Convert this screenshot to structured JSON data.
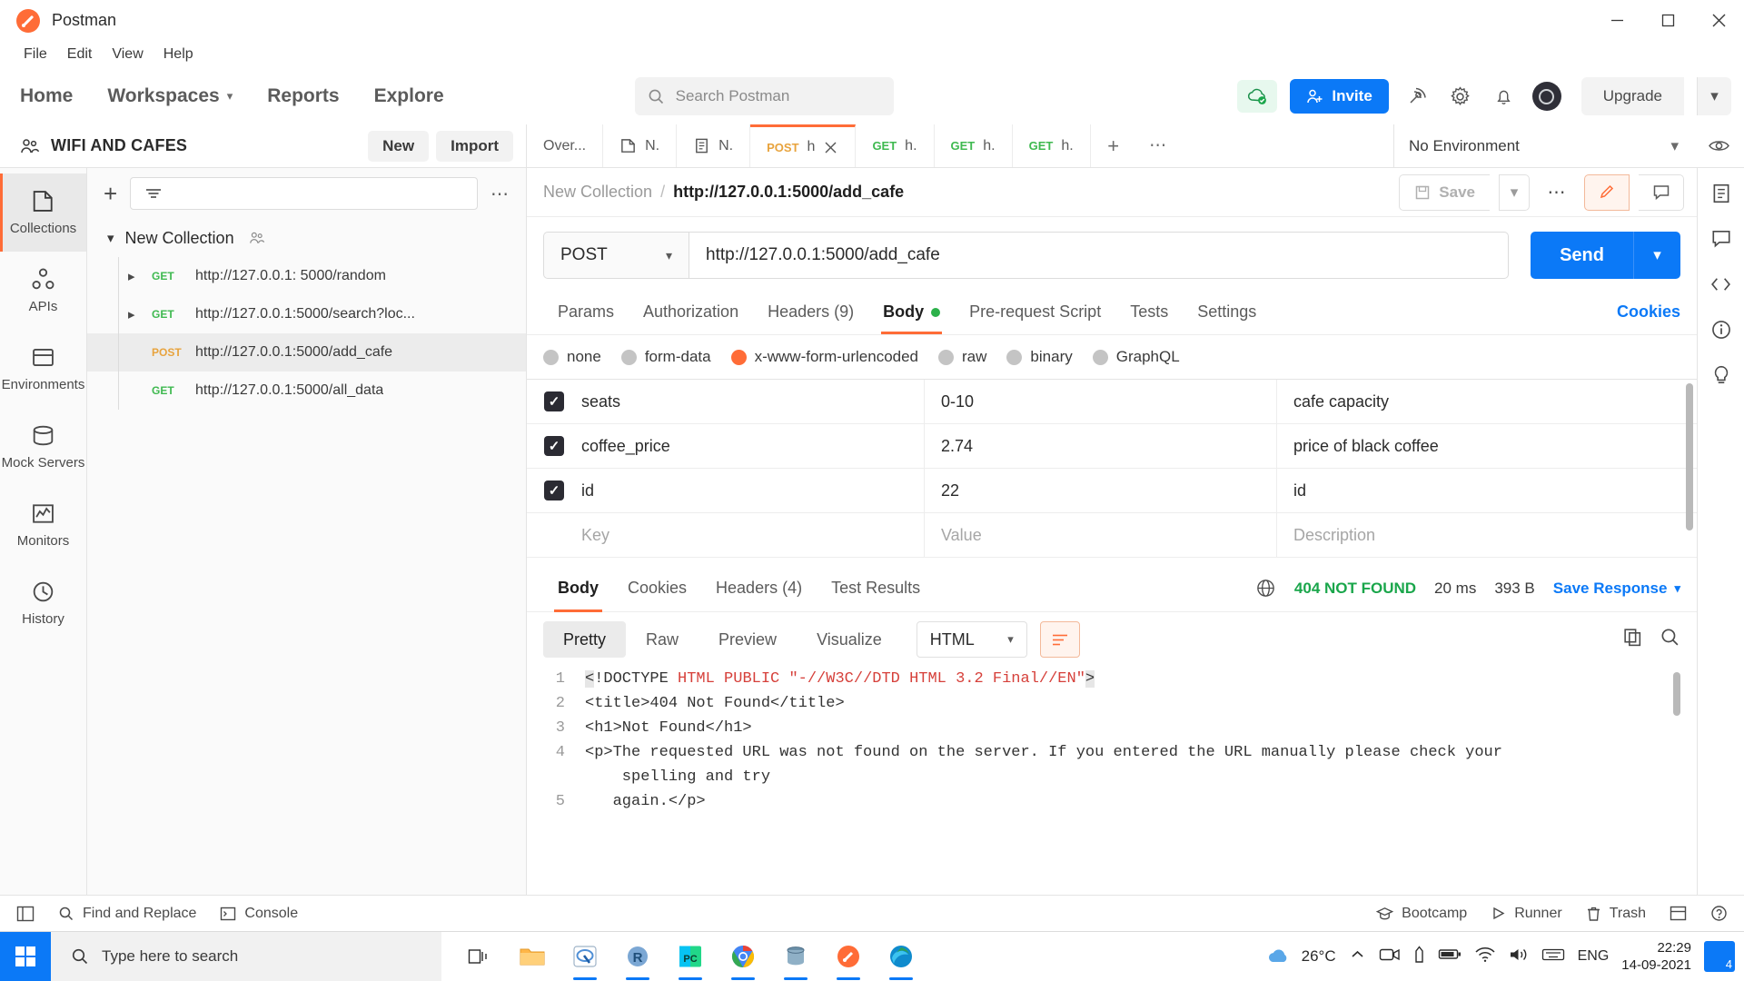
{
  "window": {
    "title": "Postman",
    "minimize": "minimize-icon",
    "maximize": "maximize-icon",
    "close": "close-icon"
  },
  "menubar": [
    "File",
    "Edit",
    "View",
    "Help"
  ],
  "header": {
    "nav": [
      "Home",
      "Workspaces",
      "Reports",
      "Explore"
    ],
    "search_placeholder": "Search Postman",
    "invite_label": "Invite",
    "upgrade_label": "Upgrade"
  },
  "workspace": {
    "name": "WIFI AND CAFES",
    "new_label": "New",
    "import_label": "Import",
    "environment": "No Environment"
  },
  "tabs": [
    {
      "label": "Over...",
      "method": "",
      "icon": "",
      "active": false
    },
    {
      "label": "N.",
      "method": "",
      "icon": "collection-icon",
      "active": false
    },
    {
      "label": "N.",
      "method": "",
      "icon": "document-icon",
      "active": false
    },
    {
      "label": "h",
      "method": "POST",
      "icon": "",
      "active": true
    },
    {
      "label": "h.",
      "method": "GET",
      "icon": "",
      "active": false
    },
    {
      "label": "h.",
      "method": "GET",
      "icon": "",
      "active": false
    },
    {
      "label": "h.",
      "method": "GET",
      "icon": "",
      "active": false
    }
  ],
  "rail": [
    {
      "label": "Collections",
      "icon": "collections-icon",
      "active": true
    },
    {
      "label": "APIs",
      "icon": "apis-icon",
      "active": false
    },
    {
      "label": "Environments",
      "icon": "environments-icon",
      "active": false
    },
    {
      "label": "Mock Servers",
      "icon": "mock-servers-icon",
      "active": false
    },
    {
      "label": "Monitors",
      "icon": "monitors-icon",
      "active": false
    },
    {
      "label": "History",
      "icon": "history-icon",
      "active": false
    }
  ],
  "sidebar": {
    "filter_placeholder": "",
    "collection_name": "New Collection",
    "requests": [
      {
        "method": "GET",
        "url": "http://127.0.0.1: 5000/random",
        "expandable": true,
        "selected": false
      },
      {
        "method": "GET",
        "url": "http://127.0.0.1:5000/search?loc...",
        "expandable": true,
        "selected": false
      },
      {
        "method": "POST",
        "url": "http://127.0.0.1:5000/add_cafe",
        "expandable": false,
        "selected": true
      },
      {
        "method": "GET",
        "url": "http://127.0.0.1:5000/all_data",
        "expandable": false,
        "selected": false
      }
    ]
  },
  "request": {
    "breadcrumb_collection": "New Collection",
    "breadcrumb_name": "http://127.0.0.1:5000/add_cafe",
    "save_label": "Save",
    "method": "POST",
    "url": "http://127.0.0.1:5000/add_cafe",
    "send_label": "Send",
    "tabs": [
      {
        "label": "Params",
        "active": false
      },
      {
        "label": "Authorization",
        "active": false
      },
      {
        "label": "Headers (9)",
        "active": false
      },
      {
        "label": "Body",
        "active": true,
        "dot": true
      },
      {
        "label": "Pre-request Script",
        "active": false
      },
      {
        "label": "Tests",
        "active": false
      },
      {
        "label": "Settings",
        "active": false
      }
    ],
    "cookies_link": "Cookies",
    "body_types": [
      {
        "label": "none",
        "selected": false
      },
      {
        "label": "form-data",
        "selected": false
      },
      {
        "label": "x-www-form-urlencoded",
        "selected": true
      },
      {
        "label": "raw",
        "selected": false
      },
      {
        "label": "binary",
        "selected": false
      },
      {
        "label": "GraphQL",
        "selected": false
      }
    ],
    "table": {
      "placeholders": {
        "key": "Key",
        "value": "Value",
        "description": "Description"
      },
      "rows": [
        {
          "checked": true,
          "key": "seats",
          "value": "0-10",
          "description": "cafe capacity"
        },
        {
          "checked": true,
          "key": "coffee_price",
          "value": "2.74",
          "description": "price of black coffee"
        },
        {
          "checked": true,
          "key": "id",
          "value": "22",
          "description": "id"
        }
      ]
    }
  },
  "response": {
    "tabs": [
      {
        "label": "Body",
        "active": true
      },
      {
        "label": "Cookies",
        "active": false
      },
      {
        "label": "Headers (4)",
        "active": false
      },
      {
        "label": "Test Results",
        "active": false
      }
    ],
    "status": "404 NOT FOUND",
    "time": "20 ms",
    "size": "393 B",
    "save_response": "Save Response",
    "view_tabs": [
      {
        "label": "Pretty",
        "active": true
      },
      {
        "label": "Raw",
        "active": false
      },
      {
        "label": "Preview",
        "active": false
      },
      {
        "label": "Visualize",
        "active": false
      }
    ],
    "language": "HTML",
    "code_lines": [
      {
        "n": "1",
        "segments": [
          {
            "t": "<",
            "c": "bracket"
          },
          {
            "t": "!DOCTYPE ",
            "c": "plain"
          },
          {
            "t": "HTML PUBLIC \"-//W3C//DTD HTML 3.2 Final//EN\"",
            "c": "red"
          },
          {
            "t": ">",
            "c": "bracket"
          }
        ]
      },
      {
        "n": "2",
        "segments": [
          {
            "t": "<title>404 Not Found</title>",
            "c": "plain"
          }
        ]
      },
      {
        "n": "3",
        "segments": [
          {
            "t": "<h1>Not Found</h1>",
            "c": "plain"
          }
        ]
      },
      {
        "n": "4",
        "segments": [
          {
            "t": "<p>The requested URL was not found on the server. If you entered the URL manually please check your",
            "c": "plain"
          }
        ]
      },
      {
        "n": "",
        "segments": [
          {
            "t": "    spelling and try",
            "c": "plain"
          }
        ]
      },
      {
        "n": "5",
        "segments": [
          {
            "t": "   again.</p>",
            "c": "plain"
          }
        ]
      }
    ]
  },
  "statusbar": {
    "left": [
      {
        "label": "",
        "icon": "sidebar-toggle-icon"
      },
      {
        "label": "Find and Replace",
        "icon": "search-icon"
      },
      {
        "label": "Console",
        "icon": "console-icon"
      }
    ],
    "right": [
      {
        "label": "Bootcamp",
        "icon": "bootcamp-icon"
      },
      {
        "label": "Runner",
        "icon": "runner-icon"
      },
      {
        "label": "Trash",
        "icon": "trash-icon"
      },
      {
        "label": "",
        "icon": "layout-icon"
      },
      {
        "label": "",
        "icon": "help-icon"
      }
    ]
  },
  "taskbar": {
    "search_placeholder": "Type here to search",
    "temperature": "26°C",
    "language": "ENG",
    "time": "22:29",
    "date": "14-09-2021",
    "notification_count": "4",
    "apps": [
      "task-view-icon",
      "file-explorer-icon",
      "rstudio-icon",
      "r-icon",
      "pycharm-icon",
      "chrome-icon",
      "database-icon",
      "postman-icon",
      "edge-icon"
    ]
  },
  "colors": {
    "accent_orange": "#ff6c37",
    "blue": "#0b79f7",
    "green": "#3fb950",
    "status_green": "#1aa64b",
    "amber": "#e8a33d"
  }
}
